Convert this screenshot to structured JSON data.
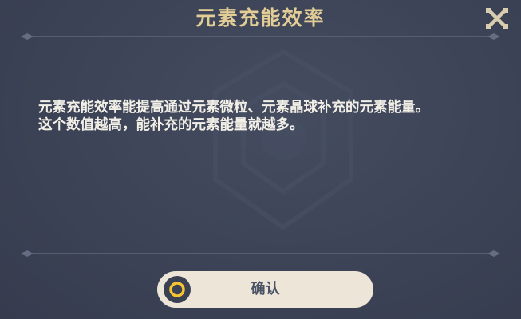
{
  "dialog": {
    "title": "元素充能效率",
    "close_icon": "close-x-icon",
    "description_line1": "元素充能效率能提高通过元素微粒、元素晶球补充的元素能量。",
    "description_line2": "这个数值越高，能补充的元素能量就越多。",
    "confirm_label": "确认",
    "confirm_icon": "circle-confirm-icon"
  },
  "colors": {
    "panel_background": "#3b4255",
    "title_gold": "#e2cd97",
    "text_light": "#f2efe6",
    "button_background": "#ece5d8",
    "button_text": "#4a5366",
    "icon_dark": "#3a4152",
    "icon_yellow": "#f5c430"
  }
}
